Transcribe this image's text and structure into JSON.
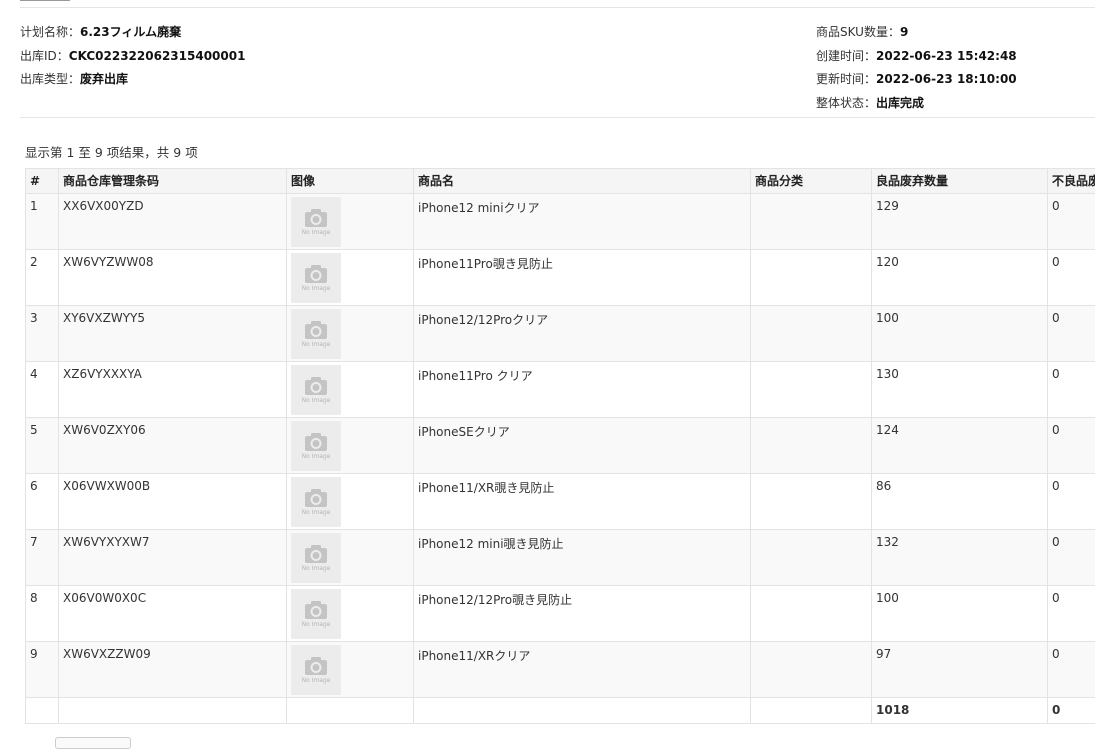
{
  "info": {
    "plan_name_label": "计划名称：",
    "plan_name": "6.23フィルム廃棄",
    "outbound_id_label": "出库ID：",
    "outbound_id": "CKC022322062315400001",
    "outbound_type_label": "出库类型：",
    "outbound_type": "废弃出库",
    "sku_count_label": "商品SKU数量：",
    "sku_count": "9",
    "created_label": "创建时间：",
    "created": "2022-06-23 15:42:48",
    "updated_label": "更新时间：",
    "updated": "2022-06-23 18:10:00",
    "status_label": "整体状态：",
    "status": "出库完成"
  },
  "summary": "显示第 1 至 9 项结果，共 9 项",
  "table": {
    "headers": {
      "index": "#",
      "barcode": "商品仓库管理条码",
      "image": "图像",
      "name": "商品名",
      "category": "商品分类",
      "good_qty": "良品废弃数量",
      "bad_qty": "不良品废"
    },
    "no_image_text": "No Image",
    "rows": [
      {
        "index": "1",
        "barcode": "XX6VX00YZD",
        "name": "iPhone12 miniクリア",
        "category": "",
        "good_qty": "129",
        "bad_qty": "0"
      },
      {
        "index": "2",
        "barcode": "XW6VYZWW08",
        "name": "iPhone11Pro覗き見防止",
        "category": "",
        "good_qty": "120",
        "bad_qty": "0"
      },
      {
        "index": "3",
        "barcode": "XY6VXZWYY5",
        "name": "iPhone12/12Proクリア",
        "category": "",
        "good_qty": "100",
        "bad_qty": "0"
      },
      {
        "index": "4",
        "barcode": "XZ6VYXXXYA",
        "name": "iPhone11Pro クリア",
        "category": "",
        "good_qty": "130",
        "bad_qty": "0"
      },
      {
        "index": "5",
        "barcode": "XW6V0ZXY06",
        "name": "iPhoneSEクリア",
        "category": "",
        "good_qty": "124",
        "bad_qty": "0"
      },
      {
        "index": "6",
        "barcode": "X06VWXW00B",
        "name": "iPhone11/XR覗き見防止",
        "category": "",
        "good_qty": "86",
        "bad_qty": "0"
      },
      {
        "index": "7",
        "barcode": "XW6VYXYXW7",
        "name": "iPhone12 mini覗き見防止",
        "category": "",
        "good_qty": "132",
        "bad_qty": "0"
      },
      {
        "index": "8",
        "barcode": "X06V0W0X0C",
        "name": "iPhone12/12Pro覗き見防止",
        "category": "",
        "good_qty": "100",
        "bad_qty": "0"
      },
      {
        "index": "9",
        "barcode": "XW6VXZZW09",
        "name": "iPhone11/XRクリア",
        "category": "",
        "good_qty": "97",
        "bad_qty": "0"
      }
    ],
    "totals": {
      "good_qty": "1018",
      "bad_qty": "0"
    }
  }
}
